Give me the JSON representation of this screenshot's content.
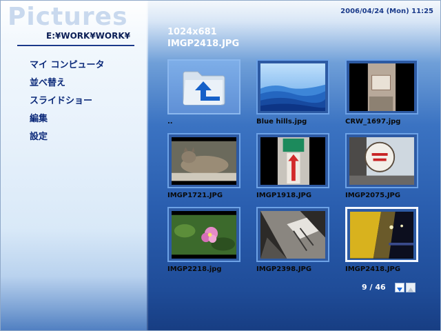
{
  "app": {
    "title": "Pictures",
    "path": "E:¥WORK¥WORK¥"
  },
  "clock": "2006/04/24 (Mon)  11:25",
  "menu": [
    {
      "label": "マイ コンピュータ"
    },
    {
      "label": "並べ替え"
    },
    {
      "label": "スライドショー"
    },
    {
      "label": "編集"
    },
    {
      "label": "設定"
    }
  ],
  "selection": {
    "resolution": "1024x681",
    "filename": "IMGP2418.JPG"
  },
  "thumbnails": [
    {
      "label": "..",
      "kind": "folder"
    },
    {
      "label": "Blue hills.jpg",
      "kind": "image"
    },
    {
      "label": "CRW_1697.jpg",
      "kind": "image"
    },
    {
      "label": "IMGP1721.JPG",
      "kind": "image"
    },
    {
      "label": "IMGP1918.JPG",
      "kind": "image"
    },
    {
      "label": "IMGP2075.JPG",
      "kind": "image"
    },
    {
      "label": "IMGP2218.jpg",
      "kind": "image"
    },
    {
      "label": "IMGP2398.JPG",
      "kind": "image"
    },
    {
      "label": "IMGP2418.JPG",
      "kind": "image",
      "selected": true
    }
  ],
  "pager": {
    "text": "9 / 46"
  },
  "colors": {
    "accent": "#1f4c98",
    "label": "#0c2a7a",
    "selection_border": "#f4f8ff"
  }
}
